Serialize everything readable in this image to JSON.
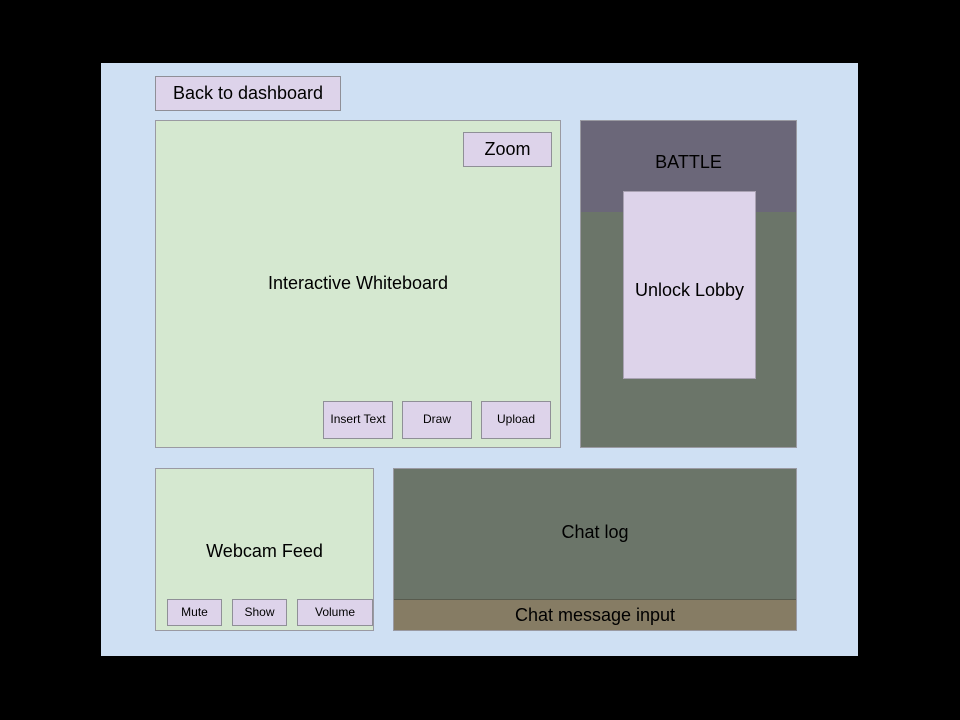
{
  "app": {
    "background_color": "#cfe0f3",
    "page_background_color": "#000000"
  },
  "toolbar": {
    "back_label": "Back to dashboard"
  },
  "whiteboard": {
    "title": "Interactive Whiteboard",
    "zoom_label": "Zoom",
    "panel_color": "#d5e8d0",
    "tools": [
      {
        "label": "Insert Text"
      },
      {
        "label": "Draw"
      },
      {
        "label": "Upload"
      }
    ]
  },
  "battle": {
    "header_label": "BATTLE",
    "header_color": "#6b6779",
    "body_color": "#6b7569",
    "modal": {
      "label": "Unlock Lobby",
      "color": "#ddd3ea"
    }
  },
  "webcam": {
    "title": "Webcam Feed",
    "panel_color": "#d5e8d0",
    "controls": [
      {
        "label": "Mute"
      },
      {
        "label": "Show"
      },
      {
        "label": "Volume"
      }
    ]
  },
  "chat": {
    "log_label": "Chat log",
    "log_color": "#6b7569",
    "input_label": "Chat message input",
    "input_color": "#867c64"
  },
  "theme": {
    "button_color": "#ddd3ea",
    "border_color": "#9a9aa2"
  }
}
